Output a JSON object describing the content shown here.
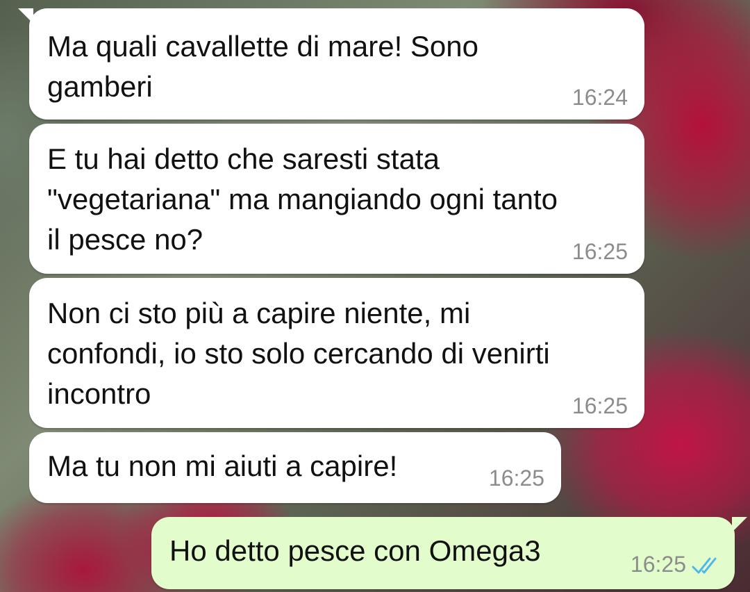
{
  "messages": [
    {
      "text": "Ma quali cavallette di mare! Sono\ngamberi",
      "time": "16:24"
    },
    {
      "text": "E tu hai detto che saresti stata\n\"vegetariana\" ma mangiando ogni tanto\nil pesce no?",
      "time": "16:25"
    },
    {
      "text": "Non ci sto più a capire niente, mi\nconfondi, io sto solo cercando di venirti\nincontro",
      "time": "16:25"
    },
    {
      "text": "Ma tu non mi aiuti a capire!",
      "time": "16:25"
    },
    {
      "text": "Ho detto pesce con Omega3",
      "time": "16:25",
      "status": "read"
    }
  ],
  "colors": {
    "incoming_bubble": "#ffffff",
    "outgoing_bubble": "#e2fdcb",
    "read_ticks": "#4fb6ec"
  },
  "icons": {
    "read_receipt": "double-check-icon"
  }
}
